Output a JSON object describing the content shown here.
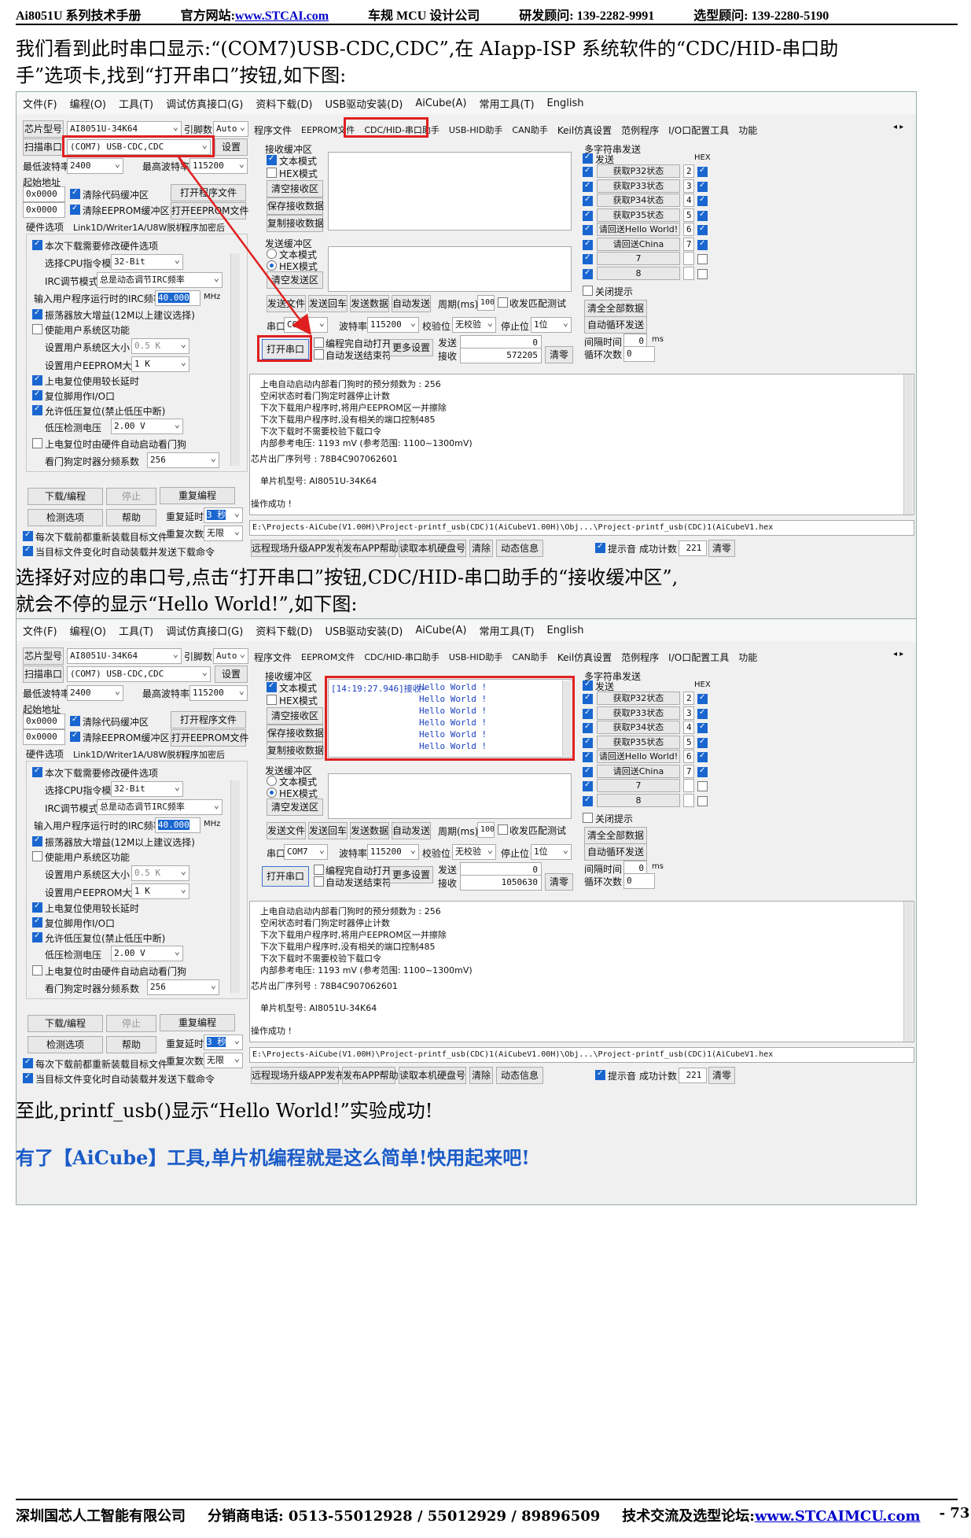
{
  "header": {
    "title": "Ai8051U 系列技术手册",
    "site_label": "官方网站:",
    "site_url": "www.STCAI.com",
    "company": "车规 MCU 设计公司",
    "advisor": "研发顾问: 139-2282-9991",
    "selection": "选型顾问: 139-2280-5190"
  },
  "para1": "我们看到此时串口显示:“(COM7)USB-CDC,CDC”,在 AIapp-ISP 系统软件的“CDC/HID-串口助",
  "para1b": "手”选项卡,找到“打开串口”按钮,如下图:",
  "para2": "选择好对应的串口号,点击“打开串口”按钮,CDC/HID-串口助手的“接收缓冲区”,",
  "para2b": "就会不停的显示“Hello World!”,如下图:",
  "para3": "至此,printf_usb()显示“Hello World!”实验成功!",
  "para4": "有了【AiCube】工具,单片机编程就是这么简单!快用起来吧!",
  "footer": {
    "company": "深圳国芯人工智能有限公司",
    "phone": "分销商电话: 0513-55012928 / 55012929 / 89896509",
    "forum_label": "技术交流及选型论坛:",
    "forum_url": "www.STCAIMCU.com",
    "page": "- 73 -"
  },
  "app": {
    "menu": [
      "文件(F)",
      "编程(O)",
      "工具(T)",
      "调试仿真接口(G)",
      "资料下载(D)",
      "USB驱动安装(D)",
      "AiCube(A)",
      "常用工具(T)",
      "English"
    ],
    "chip_label": "芯片型号",
    "chip": "AI8051U-34K64",
    "pins_label": "引脚数",
    "pins": "Auto",
    "scan_label": "扫描串口",
    "port": "(COM7) USB-CDC,CDC",
    "settings": "设置",
    "min_baud_label": "最低波特率",
    "min_baud": "2400",
    "max_baud_label": "最高波特率",
    "max_baud": "115200",
    "start_addr": "起始地址",
    "addr1": "0x0000",
    "addr2": "0x0000",
    "clear_code": "清除代码缓冲区",
    "clear_eeprom": "清除EEPROM缓冲区",
    "open_prog": "打开程序文件",
    "open_eeprom": "打开EEPROM文件",
    "hw_tabs": [
      "硬件选项",
      "Link1D/Writer1A/U8W脱机",
      "程序加密后"
    ],
    "opts": {
      "modify": "本次下载需要修改硬件选项",
      "cpu_mode_label": "选择CPU指令模式",
      "cpu_mode": "32-Bit",
      "irc_label": "IRC调节模式",
      "irc": "总是动态调节IRC频率",
      "freq_label": "输入用户程序运行时的IRC频率",
      "freq": "40.000",
      "mhz": "MHz",
      "osc": "振荡器放大增益(12M以上建议选择)",
      "sys_area": "使能用户系统区功能",
      "sys_size_label": "设置用户系统区大小",
      "sys_size": "0.5 K",
      "eeprom_size_label": "设置用户EEPROM大小",
      "eeprom_size": "1   K",
      "long_reset": "上电复位使用较长延时",
      "reset_io": "复位脚用作I/O口",
      "lvr": "允许低压复位(禁止低压中断)",
      "lv_label": "低压检测电压",
      "lv": "2.00 V",
      "wdt": "上电复位时由硬件自动启动看门狗",
      "wdt_div_label": "看门狗定时器分频系数",
      "wdt_div": "256"
    },
    "download": "下载/编程",
    "stop": "停止",
    "reprogram": "重复编程",
    "check": "检测选项",
    "help": "帮助",
    "delay_label": "重复延时",
    "delay": "3 秒",
    "times_label": "重复次数",
    "times": "无限",
    "reload": "每次下载前都重新装载目标文件",
    "auto_send": "当目标文件变化时自动装载并发送下载命令",
    "tabs": [
      "程序文件",
      "EEPROM文件",
      "CDC/HID-串口助手",
      "USB-HID助手",
      "CAN助手",
      "Keil仿真设置",
      "范例程序",
      "I/O口配置工具",
      "功能"
    ],
    "rx_label": "接收缓冲区",
    "text_mode": "文本模式",
    "hex_mode": "HEX模式",
    "clear_rx": "清空接收区",
    "save_rx": "保存接收数据",
    "copy_rx": "复制接收数据",
    "tx_label": "发送缓冲区",
    "clear_tx": "清空发送区",
    "send_btns": [
      "发送文件",
      "发送回车",
      "发送数据",
      "自动发送"
    ],
    "period_label": "周期(ms)",
    "period": "100",
    "send_match": "收发匹配测试",
    "port_label": "串口",
    "com": "COM7",
    "baud_label": "波特率",
    "baud": "115200",
    "parity_label": "校验位",
    "parity": "无校验",
    "stop_label": "停止位",
    "stopbits": "1位",
    "open_port": "打开串口",
    "auto_open": "编程完自动打开",
    "auto_end": "自动发送结束符",
    "more": "更多设置",
    "send_label": "发送",
    "recv_label": "接收",
    "send_cnt": "0",
    "clear_cnt": "清零",
    "multi_label": "多字符串发送",
    "send_ck": "发送",
    "hex": "HEX",
    "multi": [
      "获取P32状态",
      "获取P33状态",
      "获取P34状态",
      "获取P35状态",
      "请回送Hello World!",
      "请回送China",
      "7",
      "8"
    ],
    "multi_n": [
      "2",
      "3",
      "4",
      "5",
      "6",
      "7"
    ],
    "close_tip": "关闭提示",
    "clear_all": "清全全部数据",
    "auto_loop": "自动循环发送",
    "interval_label": "间隔时间",
    "interval": "0",
    "ms": "ms",
    "loop_label": "循环次数",
    "loop": "0",
    "log": [
      "上电自动启动内部看门狗时的预分频数为 : 256",
      "空闲状态时看门狗定时器停止计数",
      "下次下载用户程序时,将用户EEPROM区一并擦除",
      "下次下载用户程序时,没有相关的端口控制485",
      "下次下载时不需要校验下载口令",
      "内部参考电压: 1193 mV (参考范围: 1100~1300mV)"
    ],
    "serial": "芯片出厂序列号 : 78B4C907062601",
    "model": "单片机型号: AI8051U-34K64",
    "success": "操作成功 !",
    "path": "E:\\Projects-AiCube(V1.00H)\\Project-printf_usb(CDC)1(AiCubeV1.00H)\\Obj...\\Project-printf_usb(CDC)1(AiCubeV1.hex",
    "bottom": [
      "远程现场升级APP发布",
      "发布APP帮助",
      "读取本机硬盘号",
      "清除",
      "动态信息"
    ],
    "beep": "提示音",
    "count_label": "成功计数",
    "count": "221",
    "clear": "清零"
  },
  "shot1": {
    "recv_cnt": "572205"
  },
  "shot2": {
    "recv_cnt": "1050630",
    "rx_stamp": "[14:19:27.946]接收←",
    "hello": "Hello World !"
  }
}
